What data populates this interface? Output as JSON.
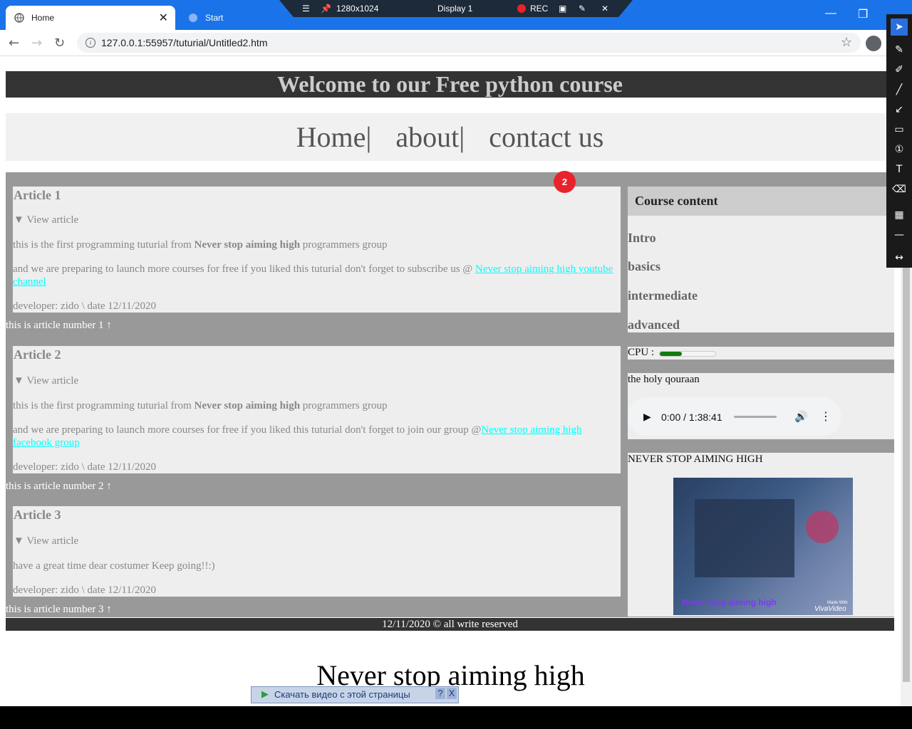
{
  "browser": {
    "tabs": [
      {
        "label": "Home",
        "active": true
      },
      {
        "label": "Start",
        "active": false
      }
    ],
    "url": "127.0.0.1:55957/tuturial/Untitled2.htm"
  },
  "recorder": {
    "resolution": "1280x1024",
    "display": "Display 1",
    "rec_label": "REC"
  },
  "page": {
    "header": "Welcome to our Free python course",
    "nav": [
      "Home|",
      "about|",
      "contact us"
    ],
    "articles": [
      {
        "title": "Article 1",
        "summary": "View article",
        "p1_pre": "this is the first programming tuturial from ",
        "p1_bold": "Never stop aiming high",
        "p1_post": " programmers group",
        "p2_pre": "and we are preparing to launch more courses for free if you liked this tuturial don't forget to subscribe us @ ",
        "p2_link": "Never stop aiming high youtube channel",
        "developer": "developer: zido \\ date 12/11/2020",
        "caption": "this is article number 1 ↑"
      },
      {
        "title": "Article 2",
        "summary": "View article",
        "p1_pre": "this is the first programming tuturial from ",
        "p1_bold": "Never stop aiming high",
        "p1_post": " programmers group",
        "p2_pre": "and we are preparing to launch more courses for free if you liked this tuturial don't forget to join our group @",
        "p2_link": "Never stop aiming high facebook group",
        "developer": "developer: zido \\ date 12/11/2020",
        "caption": "this is article number 2 ↑"
      },
      {
        "title": "Article 3",
        "summary": "View article",
        "p1": "have a great time dear costumer Keep going!!:)",
        "developer": "developer: zido \\ date 12/11/2020",
        "caption": "this is article number 3 ↑"
      }
    ],
    "aside": {
      "title": "Course content",
      "items": [
        "Intro",
        "basics",
        "intermediate",
        "advanced"
      ],
      "cpu_label": "CPU :",
      "cpu_level": 0.4,
      "audio_title": "the holy qouraan",
      "audio_time": "0:00 / 1:38:41",
      "video_title": "NEVER STOP AIMING HIGH",
      "video_overlay": "Never stop aiming high",
      "video_brand_small": "Made With",
      "video_brand": "VivaVideo"
    },
    "footer": "12/11/2020 © all write reserved",
    "bottom_heading": "Never stop aiming high"
  },
  "download_bar": {
    "label": "Скачать видео с этой страницы",
    "help": "?",
    "close": "X"
  },
  "badge": "2",
  "colors": {
    "chrome_blue": "#1a73e8",
    "header_bg": "#333333",
    "link": "#00ffff",
    "content_bg": "#999999"
  }
}
